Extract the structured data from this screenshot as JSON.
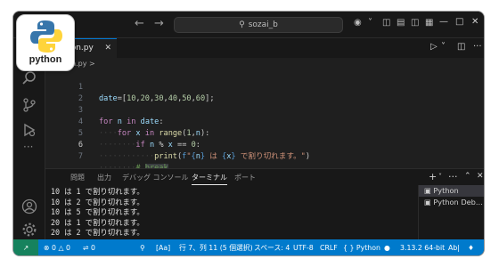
{
  "window": {
    "command_center": "sozai_b"
  },
  "tab": {
    "filename": "son.py"
  },
  "breadcrumb": "son.py >",
  "editor": {
    "active_line": 6,
    "line_numbers": [
      "1",
      "2",
      "3",
      "4",
      "5",
      "6",
      "7"
    ]
  },
  "panel": {
    "tabs": [
      "問題",
      "出力",
      "デバッグ コンソール",
      "ターミナル",
      "ポート"
    ],
    "active_tab": "ターミナル",
    "terminal_lines": [
      "10 は 1 で割り切れます。",
      "10 は 2 で割り切れます。",
      "10 は 5 で割り切れます。",
      "20 は 1 で割り切れます。",
      "20 は 2 で割り切れます。"
    ],
    "terminals": [
      "Python",
      "Python Deb..."
    ]
  },
  "statusbar": {
    "errors": "0",
    "warnings": "0",
    "ports": "0",
    "case": "[Aa]",
    "position": "行 7、列 11 (5 個選択)",
    "spaces": "スペース: 4",
    "encoding": "UTF-8",
    "eol": "CRLF",
    "language": "Python",
    "interpreter": "3.13.2 64-bit",
    "ime": "Ab|"
  },
  "logo": {
    "label": "python"
  },
  "colors": {
    "accent": "#007acc",
    "remote": "#16825d",
    "python_blue": "#3776ab",
    "python_yellow": "#ffd43b"
  }
}
